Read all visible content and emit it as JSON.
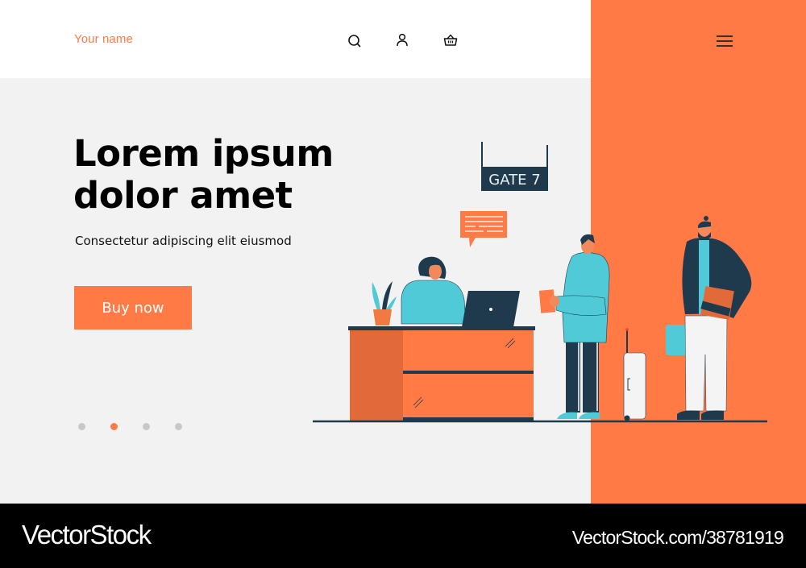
{
  "header": {
    "brand": "Your name",
    "icons": [
      "search-icon",
      "user-icon",
      "basket-icon",
      "menu-icon"
    ]
  },
  "hero": {
    "headline_line1": "Lorem ipsum",
    "headline_line2": "dolor amet",
    "subtitle": "Consectetur adipiscing elit eiusmod",
    "cta_label": "Buy now",
    "carousel": {
      "total": 4,
      "active_index": 1
    }
  },
  "illustration": {
    "gate_sign": "GATE 7"
  },
  "footer": {
    "logo": "VectorStock",
    "url": "VectorStock.com/38781919"
  },
  "colors": {
    "accent": "#ff7a45",
    "navy": "#1f3a4d",
    "teal": "#4fcad6",
    "background": "#f2f2f2"
  }
}
